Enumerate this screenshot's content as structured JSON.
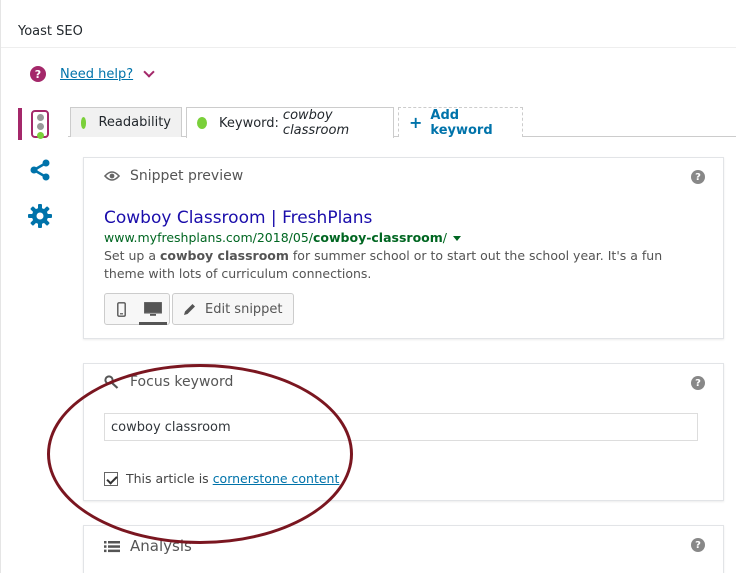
{
  "panel": {
    "title": "Yoast SEO"
  },
  "help": {
    "icon": "?",
    "label": "Need help?"
  },
  "side_tabs": [
    {
      "name": "readability-traffic-icon"
    },
    {
      "name": "share-icon"
    },
    {
      "name": "gear-icon"
    }
  ],
  "tabs": {
    "readability": "Readability",
    "keyword_prefix": "Keyword: ",
    "keyword_value": "cowboy classroom",
    "add_label": "Add keyword"
  },
  "snippet": {
    "heading": "Snippet preview",
    "title": "Cowboy Classroom | FreshPlans",
    "url_base": "www.myfreshplans.com/2018/05/",
    "url_slug": "cowboy-classroom",
    "url_tail": "/",
    "desc_pre": "Set up a ",
    "desc_bold": "cowboy classroom",
    "desc_post": " for summer school or to start out the school year. It's a fun theme with lots of curriculum connections.",
    "edit_label": "Edit snippet"
  },
  "focus": {
    "heading": "Focus keyword",
    "input_value": "cowboy classroom",
    "cornerstone_text": "This article is",
    "cornerstone_link": "cornerstone content"
  },
  "analysis": {
    "heading": "Analysis"
  },
  "colors": {
    "brand": "#a4286a",
    "good": "#7ad03a",
    "link": "#0073aa",
    "annotation": "#7a1620"
  }
}
